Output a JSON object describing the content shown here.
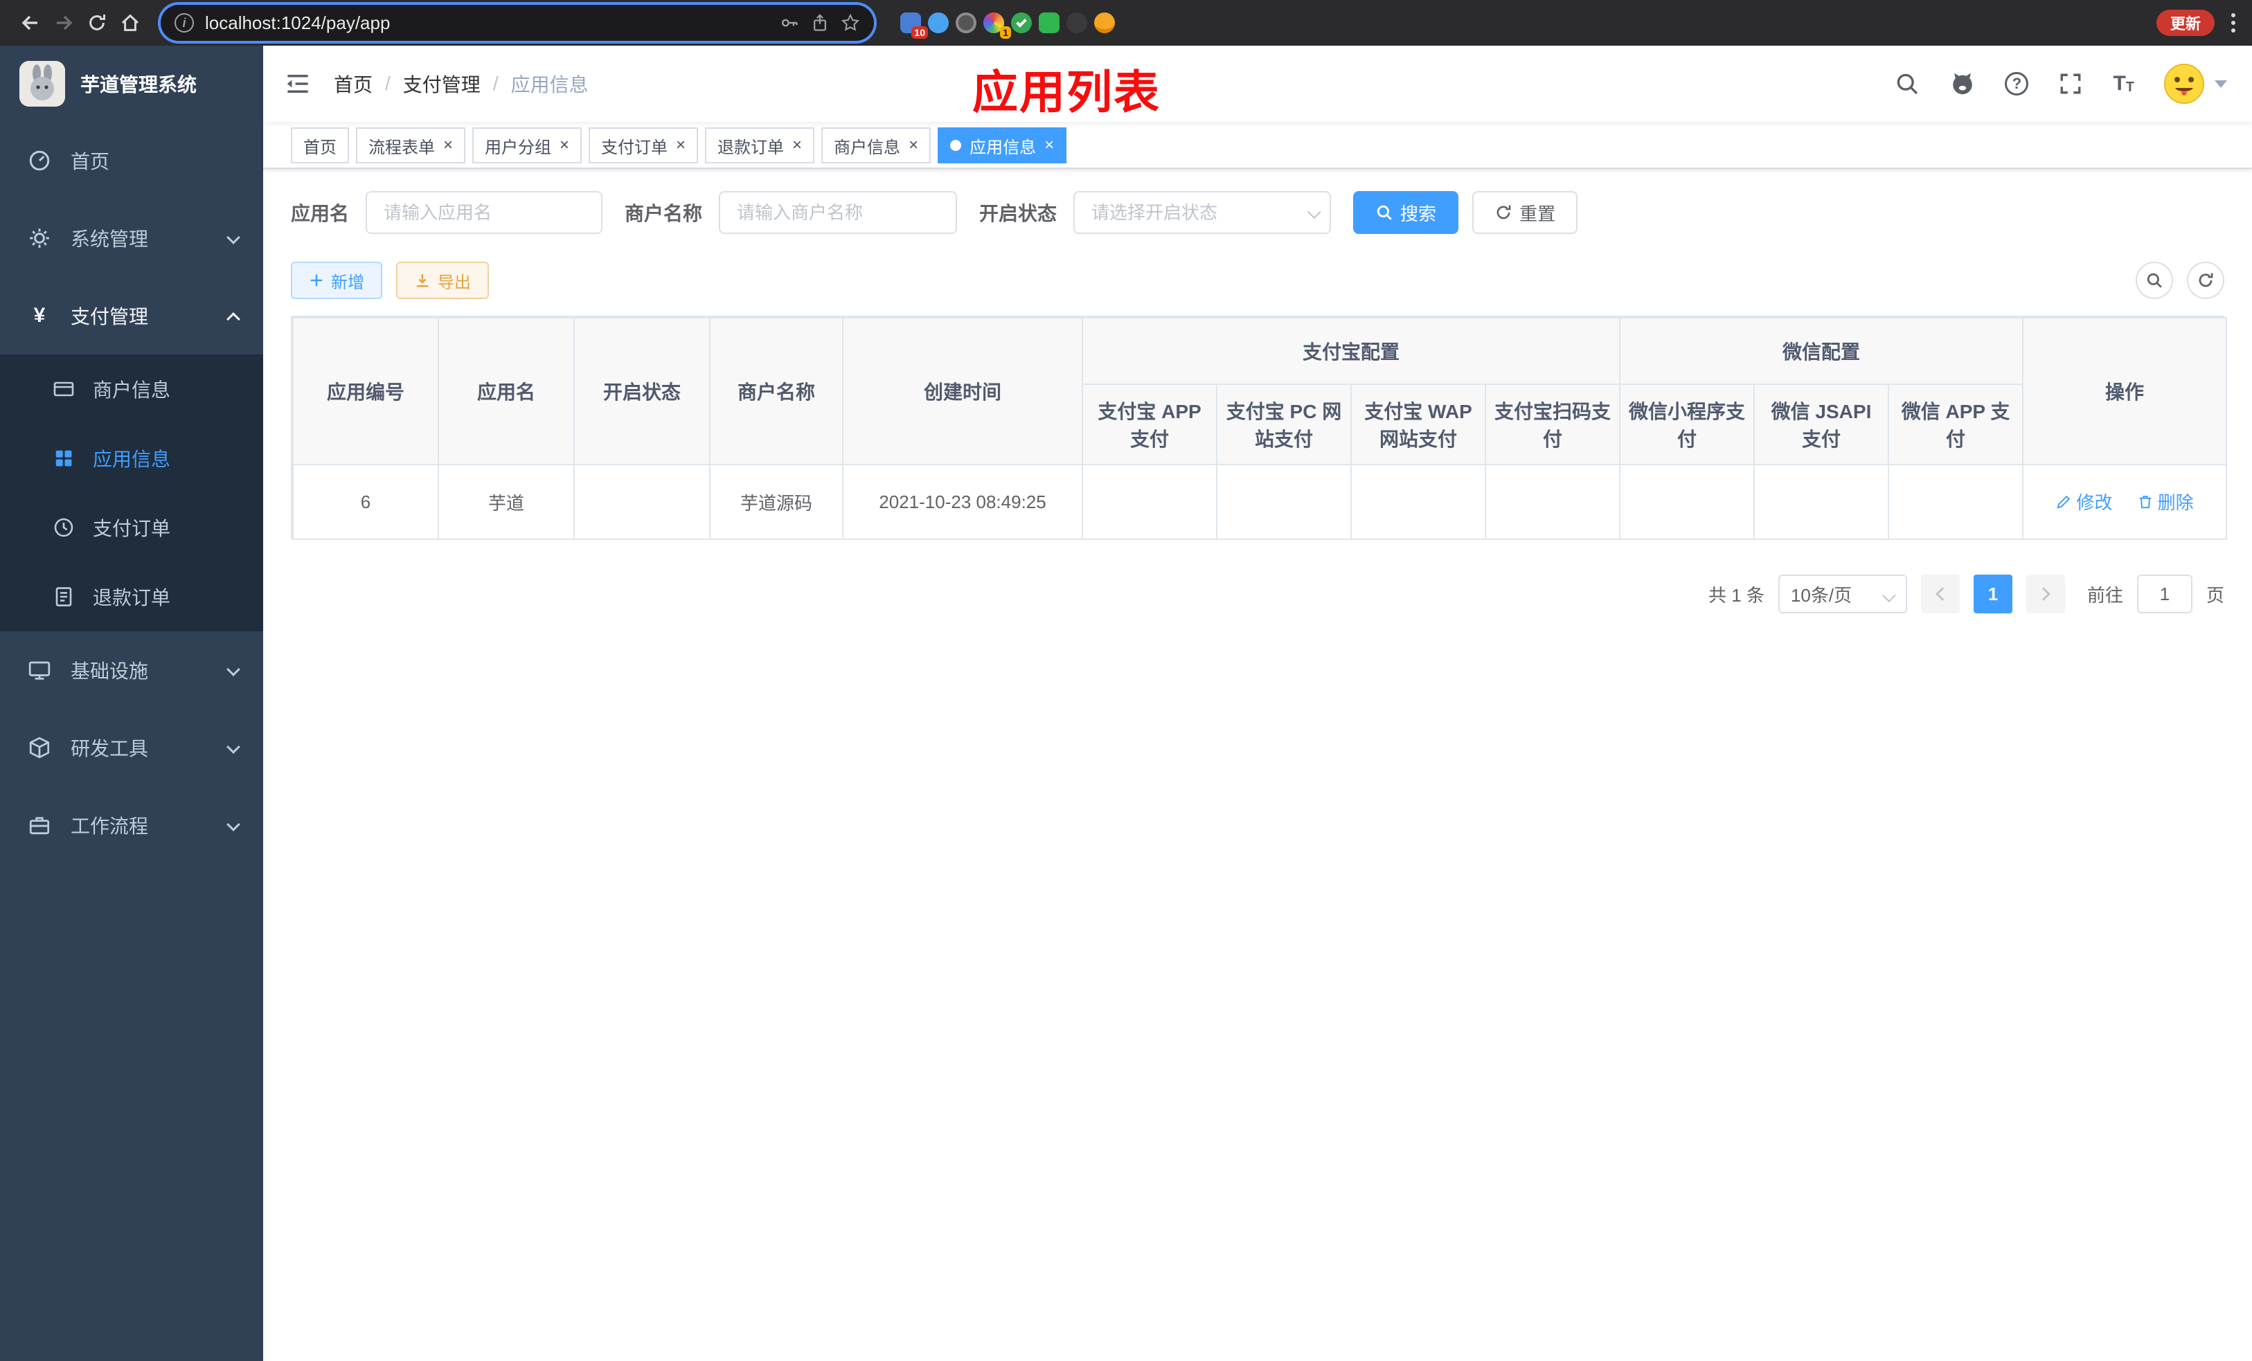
{
  "browser": {
    "url": "localhost:1024/pay/app",
    "update_label": "更新",
    "ext_badges": {
      "pinned": "10",
      "colorwheel": "1"
    }
  },
  "sidebar": {
    "title": "芋道管理系统",
    "items": [
      {
        "label": "首页"
      },
      {
        "label": "系统管理"
      },
      {
        "label": "支付管理",
        "children": [
          {
            "label": "商户信息"
          },
          {
            "label": "应用信息"
          },
          {
            "label": "支付订单"
          },
          {
            "label": "退款订单"
          }
        ]
      },
      {
        "label": "基础设施"
      },
      {
        "label": "研发工具"
      },
      {
        "label": "工作流程"
      }
    ]
  },
  "header": {
    "breadcrumb": [
      "首页",
      "支付管理",
      "应用信息"
    ],
    "annotation": "应用列表"
  },
  "tabs": [
    {
      "label": "首页",
      "closable": false,
      "active": false
    },
    {
      "label": "流程表单",
      "closable": true,
      "active": false
    },
    {
      "label": "用户分组",
      "closable": true,
      "active": false
    },
    {
      "label": "支付订单",
      "closable": true,
      "active": false
    },
    {
      "label": "退款订单",
      "closable": true,
      "active": false
    },
    {
      "label": "商户信息",
      "closable": true,
      "active": false
    },
    {
      "label": "应用信息",
      "closable": true,
      "active": true
    }
  ],
  "filters": {
    "app_name": {
      "label": "应用名",
      "placeholder": "请输入应用名"
    },
    "merchant": {
      "label": "商户名称",
      "placeholder": "请输入商户名称"
    },
    "status": {
      "label": "开启状态",
      "placeholder": "请选择开启状态"
    },
    "search_label": "搜索",
    "reset_label": "重置"
  },
  "toolbar": {
    "add_label": "新增",
    "export_label": "导出"
  },
  "table": {
    "groups": {
      "alipay": "支付宝配置",
      "wechat": "微信配置"
    },
    "columns": {
      "app_id": "应用编号",
      "app_name": "应用名",
      "status": "开启状态",
      "merchant": "商户名称",
      "created": "创建时间",
      "ops": "操作"
    },
    "alipay_cols": [
      "支付宝 APP 支付",
      "支付宝 PC 网站支付",
      "支付宝 WAP 网站支付",
      "支付宝扫码支付"
    ],
    "wechat_cols": [
      "微信小程序支付",
      "微信 JSAPI 支付",
      "微信 APP 支付"
    ],
    "row": {
      "app_id": "6",
      "app_name": "芋道",
      "enabled": true,
      "merchant": "芋道源码",
      "created": "2021-10-23 08:49:25",
      "alipay": [
        false,
        false,
        false,
        false
      ],
      "wechat": [
        false,
        true,
        false
      ],
      "edit_label": "修改",
      "delete_label": "删除"
    }
  },
  "pagination": {
    "total": "共 1 条",
    "page_size": "10条/页",
    "page": "1",
    "goto_label": "前往",
    "goto_value": "1",
    "unit": "页"
  },
  "colors": {
    "accent": "#409eff",
    "danger": "#f56c6c",
    "success": "#2dbd5f",
    "annotation": "#f70d0d"
  }
}
